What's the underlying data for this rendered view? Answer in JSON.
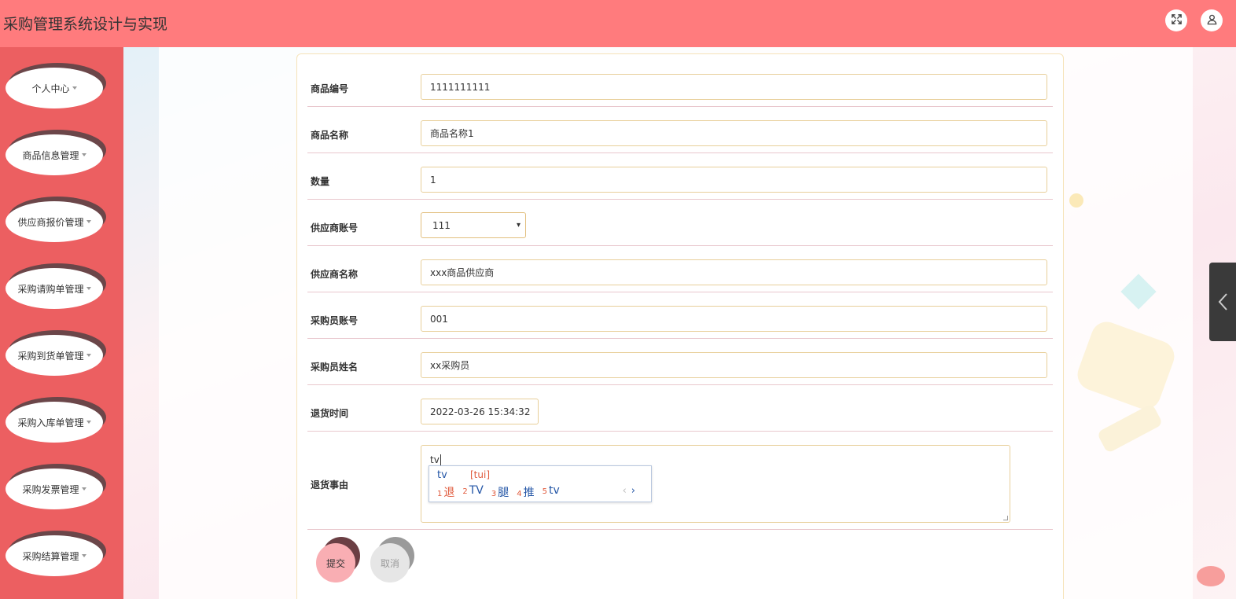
{
  "header": {
    "title": "采购管理系统设计与实现",
    "fullscreen_icon": "expand-icon",
    "user_icon": "user-icon"
  },
  "sidebar": {
    "items": [
      {
        "label": "个人中心"
      },
      {
        "label": "商品信息管理"
      },
      {
        "label": "供应商报价管理"
      },
      {
        "label": "采购请购单管理"
      },
      {
        "label": "采购到货单管理"
      },
      {
        "label": "采购入库单管理"
      },
      {
        "label": "采购发票管理"
      },
      {
        "label": "采购结算管理"
      }
    ]
  },
  "form": {
    "goods_no": {
      "label": "商品编号",
      "value": "1111111111"
    },
    "goods_name": {
      "label": "商品名称",
      "value": "商品名称1"
    },
    "quantity": {
      "label": "数量",
      "value": "1"
    },
    "supplier_account": {
      "label": "供应商账号",
      "value": "111"
    },
    "supplier_name": {
      "label": "供应商名称",
      "value": "xxx商品供应商"
    },
    "buyer_account": {
      "label": "采购员账号",
      "value": "001"
    },
    "buyer_name": {
      "label": "采购员姓名",
      "value": "xx采购员"
    },
    "return_time": {
      "label": "退货时间",
      "value": "2022-03-26 15:34:32"
    },
    "return_reason": {
      "label": "退货事由",
      "value": "tv"
    }
  },
  "ime": {
    "composition": "tv",
    "pinyin": "[tui]",
    "candidates": [
      {
        "num": "1",
        "text": "退"
      },
      {
        "num": "2",
        "text": "TV"
      },
      {
        "num": "3",
        "text": "腿"
      },
      {
        "num": "4",
        "text": "推"
      },
      {
        "num": "5",
        "text": "tv"
      }
    ],
    "prev": "‹",
    "next": "›"
  },
  "buttons": {
    "submit": "提交",
    "cancel": "取消"
  },
  "colors": {
    "header_bg": "#ff7b7d",
    "sidebar_bg": "#ec5f61",
    "submit_bg": "#f9aeb3",
    "cancel_bg": "#e6e6e6",
    "input_border": "#e8cf9a"
  }
}
